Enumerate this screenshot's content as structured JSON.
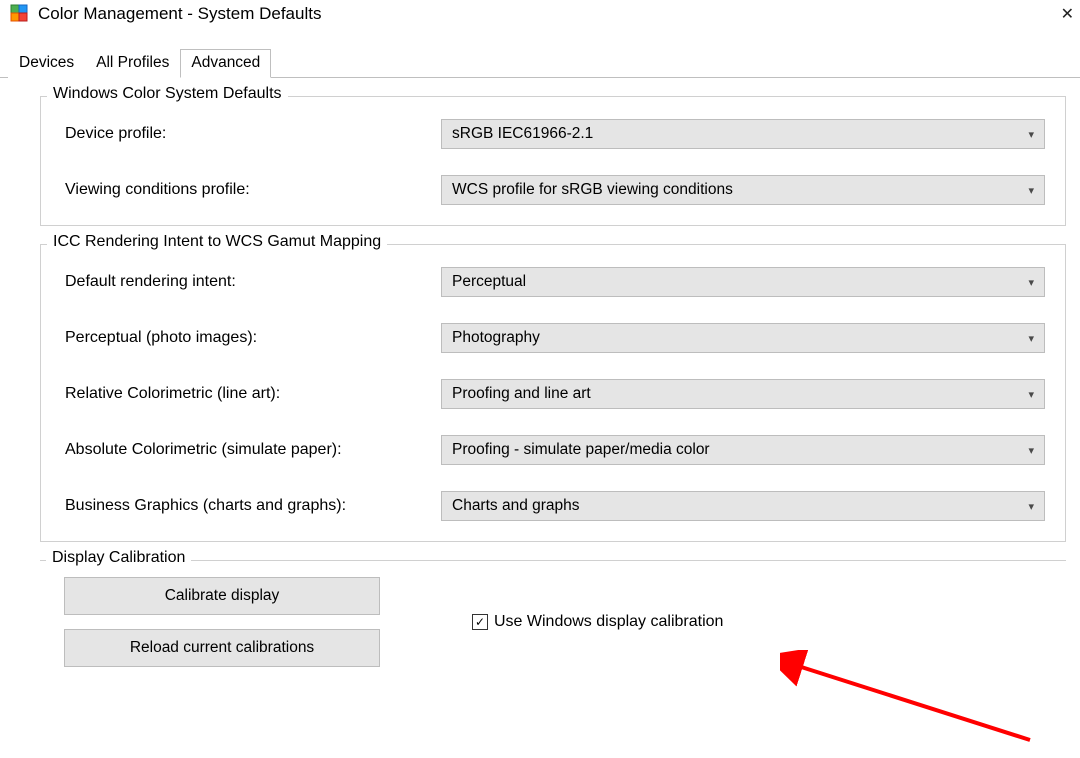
{
  "window": {
    "title": "Color Management - System Defaults"
  },
  "tabs": {
    "devices": "Devices",
    "all_profiles": "All Profiles",
    "advanced": "Advanced"
  },
  "wcs_defaults": {
    "title": "Windows Color System Defaults",
    "device_profile_label": "Device profile:",
    "device_profile_value": "sRGB IEC61966-2.1",
    "viewing_label": "Viewing conditions profile:",
    "viewing_value": "WCS profile for sRGB viewing conditions"
  },
  "icc": {
    "title": "ICC Rendering Intent to WCS Gamut Mapping",
    "default_label": "Default rendering intent:",
    "default_value": "Perceptual",
    "perceptual_label": "Perceptual (photo images):",
    "perceptual_value": "Photography",
    "relative_label": "Relative Colorimetric (line art):",
    "relative_value": "Proofing and line art",
    "absolute_label": "Absolute Colorimetric (simulate paper):",
    "absolute_value": "Proofing - simulate paper/media color",
    "business_label": "Business Graphics (charts and graphs):",
    "business_value": "Charts and graphs"
  },
  "calibration": {
    "title": "Display Calibration",
    "calibrate_btn": "Calibrate display",
    "reload_btn": "Reload current calibrations",
    "use_windows_label": "Use Windows display calibration",
    "use_windows_checked": "✓"
  }
}
